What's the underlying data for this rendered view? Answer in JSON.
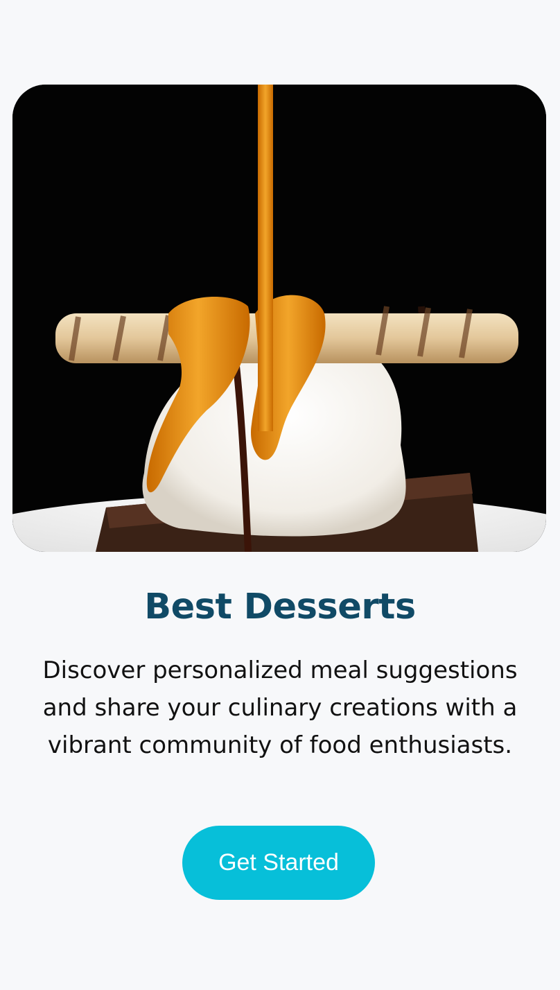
{
  "hero": {
    "image_name": "dessert-photo"
  },
  "onboarding": {
    "title": "Best Desserts",
    "description": "Discover personalized meal suggestions and share your culinary creations with a vibrant community of food enthusiasts.",
    "cta_label": "Get Started"
  },
  "colors": {
    "background": "#f7f8fa",
    "title": "#104a66",
    "button": "#07bfd9",
    "button_text": "#ffffff"
  }
}
